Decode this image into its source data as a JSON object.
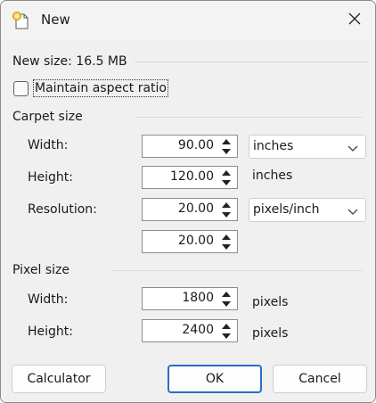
{
  "window": {
    "title": "New"
  },
  "info": {
    "new_size": "New size: 16.5 MB"
  },
  "options": {
    "maintain_aspect": "Maintain aspect ratio",
    "maintain_aspect_checked": false
  },
  "carpet": {
    "heading": "Carpet size",
    "width_label": "Width:",
    "width_value": "90.00",
    "width_unit": "inches",
    "height_label": "Height:",
    "height_value": "120.00",
    "height_unit": "inches",
    "resolution_label": "Resolution:",
    "resolution_x": "20.00",
    "resolution_unit": "pixels/inch",
    "resolution_y": "20.00"
  },
  "pixel": {
    "heading": "Pixel size",
    "width_label": "Width:",
    "width_value": "1800",
    "width_unit": "pixels",
    "height_label": "Height:",
    "height_value": "2400",
    "height_unit": "pixels"
  },
  "buttons": {
    "calculator": "Calculator",
    "ok": "OK",
    "cancel": "Cancel"
  },
  "icons": {
    "app": "new-document-icon",
    "close": "close-icon",
    "spin_up": "spin-up-icon",
    "spin_down": "spin-down-icon",
    "dropdown": "chevron-down-icon"
  },
  "colors": {
    "accent": "#2a6ec5"
  }
}
